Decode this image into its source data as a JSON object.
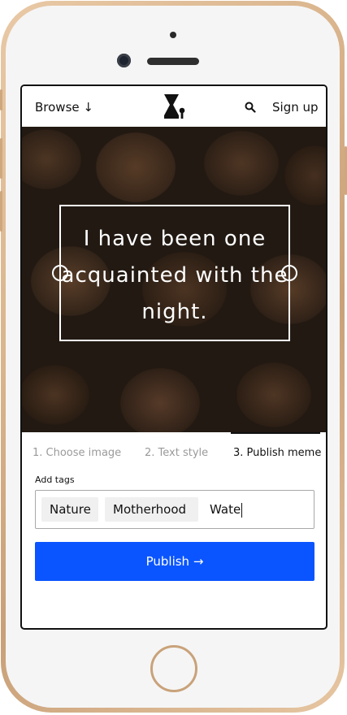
{
  "header": {
    "browse_label": "Browse ↓",
    "logo_icon": "hourglass-keyhole-logo",
    "search_icon": "search-icon",
    "signup_label": "Sign up"
  },
  "editor": {
    "meme_text": "I have been one acquainted with the night.",
    "background": "stacked firewood logs photo"
  },
  "steps": {
    "items": [
      "1. Choose image",
      "2. Text style",
      "3. Publish meme"
    ],
    "active_index": 2
  },
  "tags": {
    "label": "Add tags",
    "chips": [
      "Nature",
      "Motherhood"
    ],
    "typed_value": "Wate"
  },
  "publish": {
    "label": "Publish →",
    "color": "#0a55ff"
  }
}
